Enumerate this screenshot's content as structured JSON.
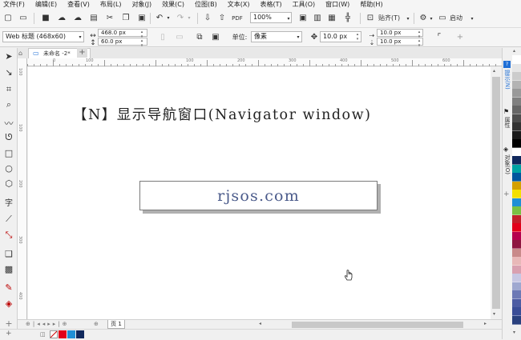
{
  "menu": [
    "文件(F)",
    "编辑(E)",
    "查看(V)",
    "布局(L)",
    "对象(J)",
    "效果(C)",
    "位图(B)",
    "文本(X)",
    "表格(T)",
    "工具(O)",
    "窗口(W)",
    "帮助(H)"
  ],
  "toolbar": {
    "zoom_value": "100%",
    "snap_label": "贴齐(T)",
    "launch_label": "启动"
  },
  "propertybar": {
    "page_preset": "Web 标题 (468x60)",
    "width_value": "468.0 px",
    "height_value": "60.0 px",
    "unit_label": "单位:",
    "unit_value": "像素",
    "nudge_value": "10.0 px",
    "dup_x": "10.0 px",
    "dup_y": "10.0 px"
  },
  "document_tab": "未命名 -2*",
  "ruler": {
    "h_ticks": [
      "0",
      "100",
      "100",
      "200",
      "300",
      "400",
      "500",
      "600"
    ],
    "v_ticks": [
      "100",
      "100",
      "200",
      "300",
      "400"
    ]
  },
  "canvas": {
    "heading": "【N】显示导航窗口(Navigator window)",
    "url_text": "rjsos.com"
  },
  "page_nav": {
    "page_label": "页 1"
  },
  "right_panel": {
    "tab_hints": "提示(N)",
    "tab_properties": "属性",
    "tab_objects": "对象(O)"
  },
  "palette_colors": [
    "#ffffff",
    "#e6e6e6",
    "#cccccc",
    "#b3b3b3",
    "#999999",
    "#808080",
    "#666666",
    "#4d4d4d",
    "#333333",
    "#1a1a1a",
    "#000000",
    "#ffffff",
    "#10285c",
    "#00a3a3",
    "#00569e",
    "#d4a000",
    "#f3e000",
    "#1f8fd6",
    "#7ac143",
    "#c21f2b",
    "#e2001a",
    "#b6004e",
    "#8e1640",
    "#c98a8a",
    "#e8b8b8",
    "#d9a0b0",
    "#c7c7e3",
    "#9fa8d0",
    "#6d79b5",
    "#4d5ca3",
    "#3a4d97",
    "#29407e"
  ],
  "status_colors": [
    "#e2001a",
    "#1f8fd6",
    "#10285c"
  ],
  "colors": {
    "accent": "#1f6fd6",
    "canvas_text": "#222222",
    "url_text": "#4a5a8a"
  }
}
